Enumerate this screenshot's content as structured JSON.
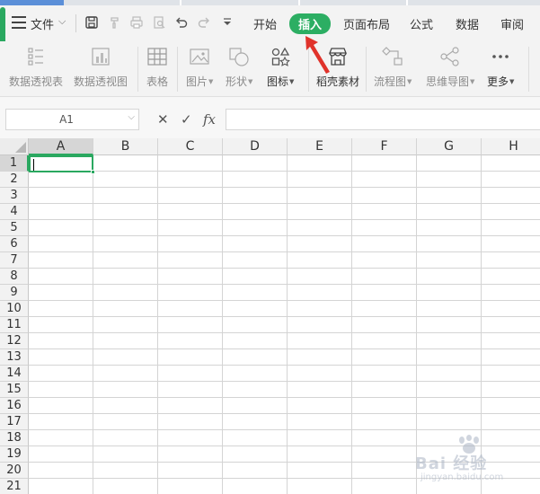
{
  "menu": {
    "file_label": "文件",
    "tabs": [
      {
        "label": "开始",
        "active": false
      },
      {
        "label": "插入",
        "active": true
      },
      {
        "label": "页面布局",
        "active": false
      },
      {
        "label": "公式",
        "active": false
      },
      {
        "label": "数据",
        "active": false
      },
      {
        "label": "审阅",
        "active": false
      }
    ]
  },
  "ribbon": {
    "pivot_table": "数据透视表",
    "pivot_chart": "数据透视图",
    "table": "表格",
    "picture": "图片",
    "shape": "形状",
    "icon": "图标",
    "material": "稻壳素材",
    "flowchart": "流程图",
    "mindmap": "思维导图",
    "more": "更多"
  },
  "formula_bar": {
    "name_box": "A1",
    "formula": ""
  },
  "sheet": {
    "columns": [
      "A",
      "B",
      "C",
      "D",
      "E",
      "F",
      "G",
      "H"
    ],
    "rows": [
      "1",
      "2",
      "3",
      "4",
      "5",
      "6",
      "7",
      "8",
      "9",
      "10",
      "11",
      "12",
      "13",
      "14",
      "15",
      "16",
      "17",
      "18",
      "19",
      "20",
      "21"
    ],
    "active_cell": "A1"
  },
  "watermark": {
    "text": "Bai 经验",
    "url": "jingyan.baidu.com"
  },
  "colors": {
    "accent": "#2cae63",
    "arrow": "#e0332b"
  }
}
